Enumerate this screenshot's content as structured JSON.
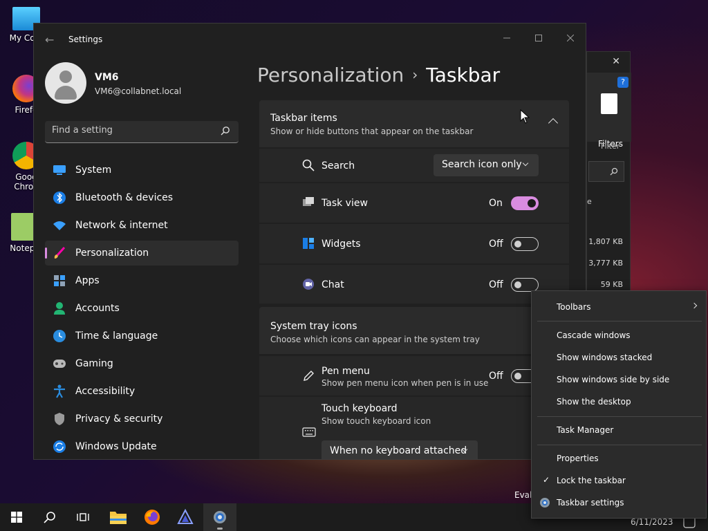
{
  "desktop": {
    "icons": [
      {
        "label": "My Com"
      },
      {
        "label": "Firefo"
      },
      {
        "label": "Goog Chron"
      },
      {
        "label": "Notepa"
      }
    ],
    "eval_text": "Evalu"
  },
  "explorer": {
    "filters_label": "Filters",
    "filter_group": "Filter",
    "sizes": [
      "1,807 KB",
      "3,777 KB",
      "59 KB"
    ],
    "help": "?",
    "close": "✕",
    "letter": "e"
  },
  "settings": {
    "title": "Settings",
    "back": "←",
    "user": {
      "name": "VM6",
      "email": "VM6@collabnet.local"
    },
    "search_placeholder": "Find a setting",
    "nav": [
      {
        "label": "System"
      },
      {
        "label": "Bluetooth & devices"
      },
      {
        "label": "Network & internet"
      },
      {
        "label": "Personalization"
      },
      {
        "label": "Apps"
      },
      {
        "label": "Accounts"
      },
      {
        "label": "Time & language"
      },
      {
        "label": "Gaming"
      },
      {
        "label": "Accessibility"
      },
      {
        "label": "Privacy & security"
      },
      {
        "label": "Windows Update"
      }
    ],
    "breadcrumb": {
      "parent": "Personalization",
      "separator": "›",
      "current": "Taskbar"
    },
    "taskbar_items": {
      "title": "Taskbar items",
      "subtitle": "Show or hide buttons that appear on the taskbar",
      "search": {
        "label": "Search",
        "value": "Search icon only"
      },
      "task_view": {
        "label": "Task view",
        "state": "On"
      },
      "widgets": {
        "label": "Widgets",
        "state": "Off"
      },
      "chat": {
        "label": "Chat",
        "state": "Off"
      }
    },
    "system_tray": {
      "title": "System tray icons",
      "subtitle": "Choose which icons can appear in the system tray",
      "pen_menu": {
        "label": "Pen menu",
        "sub": "Show pen menu icon when pen is in use",
        "state": "Off"
      },
      "touch_keyboard": {
        "label": "Touch keyboard",
        "sub": "Show touch keyboard icon",
        "value": "When no keyboard attached"
      }
    }
  },
  "context_menu": {
    "toolbars": "Toolbars",
    "cascade": "Cascade windows",
    "stacked": "Show windows stacked",
    "side_by_side": "Show windows side by side",
    "desktop": "Show the desktop",
    "task_manager": "Task Manager",
    "properties": "Properties",
    "lock": "Lock the taskbar",
    "lock_check": "✓",
    "taskbar_settings": "Taskbar settings"
  },
  "taskbar": {
    "date": "6/11/2023"
  },
  "colors": {
    "accent": "#d98ce0"
  }
}
